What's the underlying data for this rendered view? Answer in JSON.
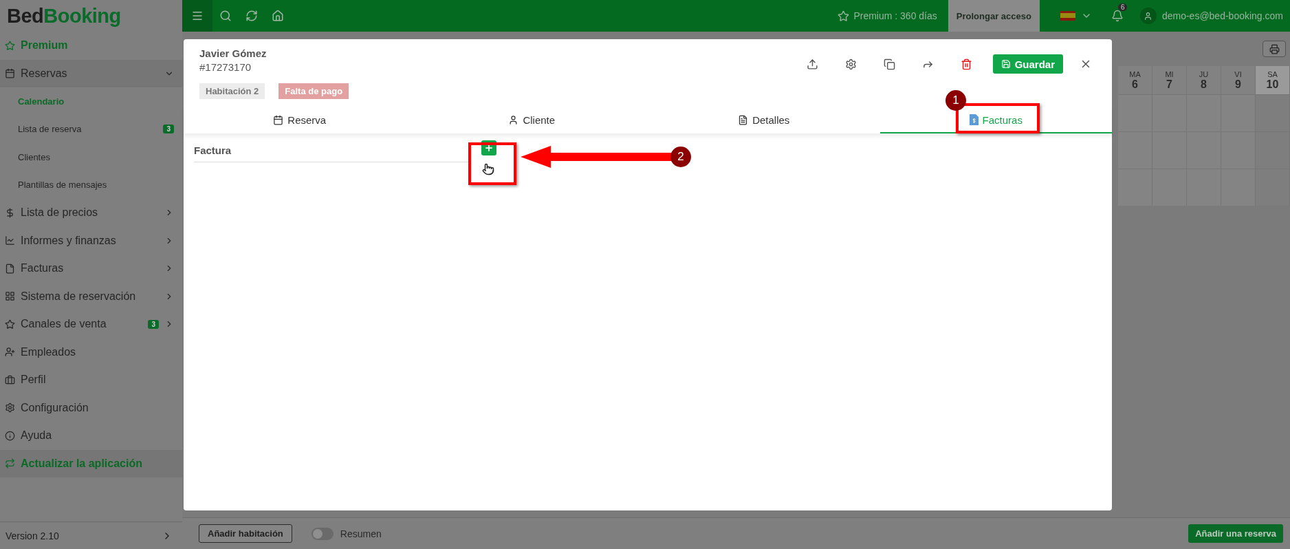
{
  "brand": {
    "part1": "Bed",
    "part2": "Booking"
  },
  "topbar": {
    "premium": "Premium : 360 días",
    "extend_button": "Prolongar acceso",
    "notifications": "6",
    "user": "demo-es@bed-booking.com"
  },
  "sidebar": {
    "items": [
      {
        "label": "Premium",
        "kind": "highlight"
      },
      {
        "label": "Reservas",
        "kind": "group",
        "expanded": true,
        "children": [
          {
            "label": "Calendario",
            "selected": true
          },
          {
            "label": "Lista de reserva",
            "selected": false,
            "badge": "3"
          },
          {
            "label": "Clientes",
            "selected": false
          },
          {
            "label": "Plantillas de mensajes",
            "selected": false
          }
        ]
      },
      {
        "label": "Lista de precios",
        "kind": "group",
        "expanded": false
      },
      {
        "label": "Informes y finanzas",
        "kind": "group",
        "expanded": false
      },
      {
        "label": "Facturas",
        "kind": "group",
        "expanded": false
      },
      {
        "label": "Sistema de reservación",
        "kind": "group",
        "expanded": false
      },
      {
        "label": "Canales de venta",
        "kind": "group",
        "expanded": false,
        "badge": "3"
      },
      {
        "label": "Empleados",
        "kind": "link"
      },
      {
        "label": "Perfil",
        "kind": "link"
      },
      {
        "label": "Configuración",
        "kind": "link"
      },
      {
        "label": "Ayuda",
        "kind": "link"
      },
      {
        "label": "Actualizar la aplicación",
        "kind": "highlight"
      }
    ],
    "version": "Version 2.10"
  },
  "calendar": {
    "days": [
      {
        "weekday": "MA",
        "day": "6",
        "weekend": false
      },
      {
        "weekday": "MI",
        "day": "7",
        "weekend": false
      },
      {
        "weekday": "JU",
        "day": "8",
        "weekend": false
      },
      {
        "weekday": "VI",
        "day": "9",
        "weekend": false
      },
      {
        "weekday": "SA",
        "day": "10",
        "weekend": true
      }
    ]
  },
  "modal": {
    "guest_name": "Javier Gómez",
    "booking_id": "#17273170",
    "tags": [
      {
        "label": "Habitación 2",
        "kind": "room"
      },
      {
        "label": "Falta de pago",
        "kind": "unpaid"
      }
    ],
    "save_button": "Guardar",
    "tabs": [
      {
        "label": "Reserva",
        "selected": false
      },
      {
        "label": "Cliente",
        "selected": false
      },
      {
        "label": "Detalles",
        "selected": false
      },
      {
        "label": "Facturas",
        "selected": true
      }
    ],
    "section_title": "Factura"
  },
  "annotations": [
    {
      "number": "1"
    },
    {
      "number": "2"
    }
  ],
  "bottom": {
    "add_room_button": "Añadir habitación",
    "summary": {
      "label": "Resumen",
      "on": false
    },
    "add_booking_button": "Añadir una reserva"
  }
}
